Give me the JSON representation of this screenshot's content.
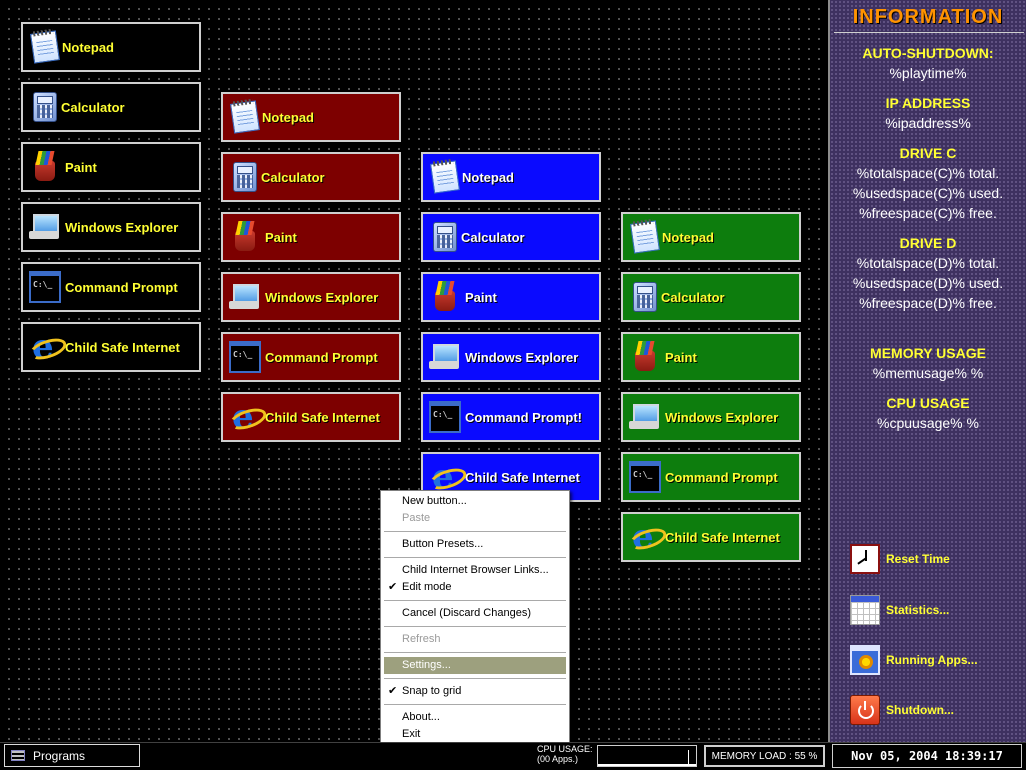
{
  "desktop": {
    "col_black": [
      {
        "label": "Notepad",
        "icon": "notepad"
      },
      {
        "label": "Calculator",
        "icon": "calc"
      },
      {
        "label": "Paint",
        "icon": "paint"
      },
      {
        "label": "Windows Explorer",
        "icon": "explorer"
      },
      {
        "label": "Command Prompt",
        "icon": "cmd"
      },
      {
        "label": "Child Safe Internet",
        "icon": "ie"
      }
    ],
    "col_red": [
      {
        "label": "Notepad",
        "icon": "notepad"
      },
      {
        "label": "Calculator",
        "icon": "calc"
      },
      {
        "label": "Paint",
        "icon": "paint"
      },
      {
        "label": "Windows Explorer",
        "icon": "explorer"
      },
      {
        "label": "Command Prompt",
        "icon": "cmd"
      },
      {
        "label": "Child Safe Internet",
        "icon": "ie"
      }
    ],
    "col_blue": [
      {
        "label": "Notepad",
        "icon": "notepad"
      },
      {
        "label": "Calculator",
        "icon": "calc"
      },
      {
        "label": "Paint",
        "icon": "paint"
      },
      {
        "label": "Windows Explorer",
        "icon": "explorer"
      },
      {
        "label": "Command Prompt!",
        "icon": "cmd"
      },
      {
        "label": "Child Safe Internet",
        "icon": "ie"
      }
    ],
    "col_green": [
      {
        "label": "Notepad",
        "icon": "notepad"
      },
      {
        "label": "Calculator",
        "icon": "calc"
      },
      {
        "label": "Paint",
        "icon": "paint"
      },
      {
        "label": "Windows Explorer",
        "icon": "explorer"
      },
      {
        "label": "Command Prompt",
        "icon": "cmd"
      },
      {
        "label": "Child Safe Internet",
        "icon": "ie"
      }
    ]
  },
  "sidebar": {
    "title": "INFORMATION",
    "sections": [
      {
        "head": "AUTO-SHUTDOWN:",
        "lines": [
          "%playtime%"
        ]
      },
      {
        "head": "IP ADDRESS",
        "lines": [
          "%ipaddress%"
        ]
      },
      {
        "head": "DRIVE C",
        "lines": [
          "%totalspace(C)% total.",
          "%usedspace(C)% used.",
          "%freespace(C)% free."
        ]
      },
      {
        "head": "DRIVE D",
        "lines": [
          "%totalspace(D)% total.",
          "%usedspace(D)% used.",
          "%freespace(D)% free."
        ]
      },
      {
        "head": "MEMORY USAGE",
        "lines": [
          "%memusage% %"
        ]
      },
      {
        "head": "CPU USAGE",
        "lines": [
          "%cpuusage% %"
        ]
      }
    ],
    "actions": {
      "reset_time": "Reset Time",
      "statistics": "Statistics...",
      "running_apps": "Running Apps...",
      "shutdown": "Shutdown..."
    }
  },
  "context_menu": {
    "new_button": "New button...",
    "paste": "Paste",
    "button_presets": "Button Presets...",
    "child_links": "Child Internet Browser Links...",
    "edit_mode": "Edit mode",
    "cancel": "Cancel (Discard Changes)",
    "refresh": "Refresh",
    "settings": "Settings...",
    "snap_to_grid": "Snap to grid",
    "about": "About...",
    "exit": "Exit",
    "check_mark": "✔"
  },
  "taskbar": {
    "programs": "Programs",
    "cpu_label_1": "CPU USAGE:",
    "cpu_label_2": "(00 Apps.)",
    "memory_load": "MEMORY LOAD : 55 %",
    "clock": "Nov 05, 2004 18:39:17"
  }
}
